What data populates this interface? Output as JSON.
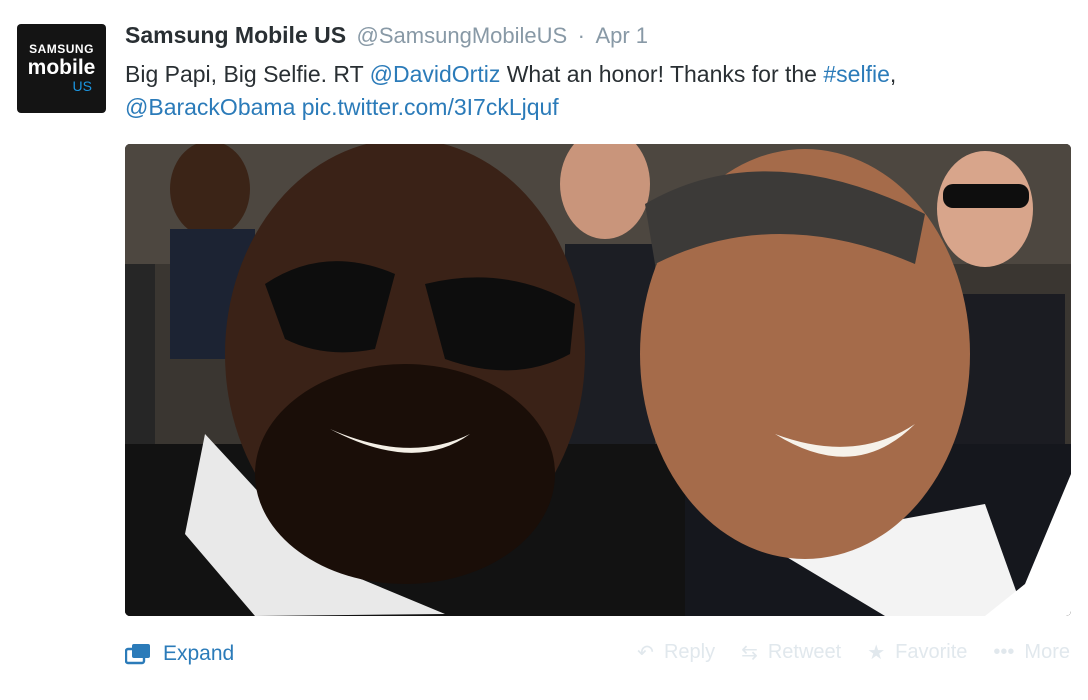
{
  "tweet": {
    "avatar": {
      "line1": "SAMSUNG",
      "line2": "mobile",
      "line3": "US"
    },
    "fullname": "Samsung Mobile US",
    "screen_name": "@SamsungMobileUS",
    "separator": "·",
    "time": "Apr 1",
    "text": {
      "part1": "Big Papi, Big Selfie. RT ",
      "mention1": "@DavidOrtiz",
      "part2": " What an honor! Thanks for the ",
      "hashtag": "#selfie",
      "part3": ",",
      "mention2": "@BarackObama",
      "link": "pic.twitter.com/3I7ckLjquf"
    }
  },
  "footer": {
    "expand": "Expand",
    "reply": "Reply",
    "retweet": "Retweet",
    "favorite": "Favorite",
    "more": "More"
  },
  "colors": {
    "link": "#2b7bb9",
    "meta": "#8899a6",
    "action_faded": "#e1e8ed"
  }
}
